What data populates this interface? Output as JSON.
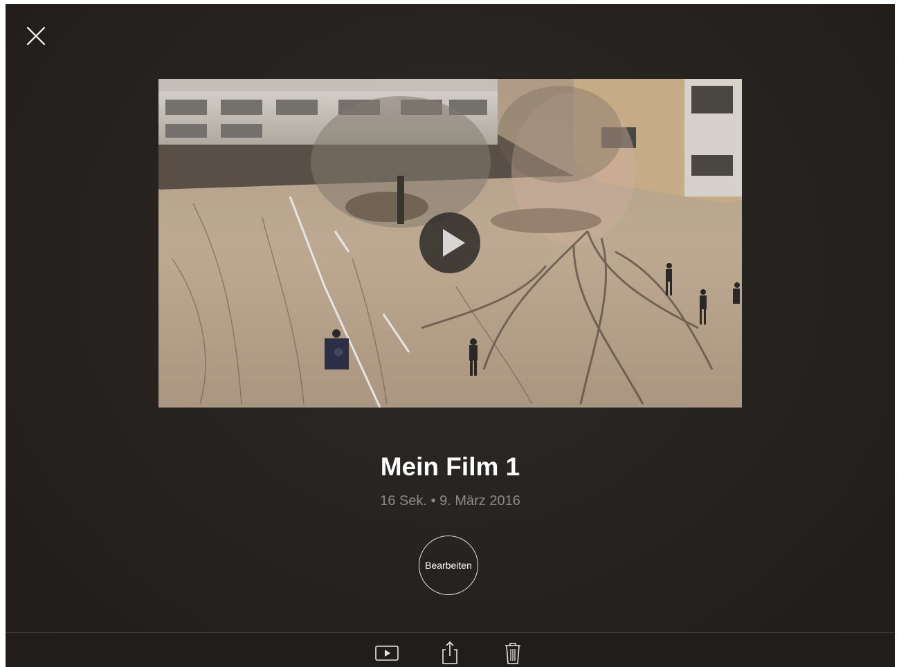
{
  "header": {
    "close_icon": "close-icon"
  },
  "video": {
    "play_icon": "play-icon"
  },
  "project": {
    "title": "Mein Film 1",
    "meta": "16 Sek. • 9. März 2016"
  },
  "actions": {
    "edit_label": "Bearbeiten"
  },
  "toolbar": {
    "icons": [
      "play-icon",
      "share-icon",
      "trash-icon"
    ]
  },
  "colors": {
    "background": "#262220",
    "text_primary": "#ffffff",
    "text_secondary": "#8e8a86"
  }
}
